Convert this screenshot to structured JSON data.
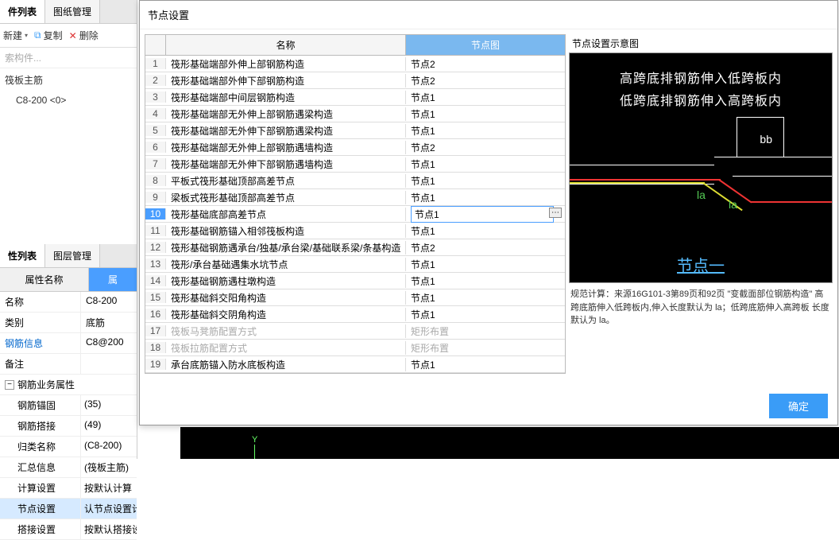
{
  "leftTabs": {
    "t1": "件列表",
    "t2": "图纸管理"
  },
  "toolbar": {
    "new": "新建",
    "copy": "复制",
    "del": "删除"
  },
  "search_placeholder": "索构件...",
  "section": "筏板主筋",
  "treeItem": "C8-200 <0>",
  "lowerTabs": {
    "t1": "性列表",
    "t2": "图层管理"
  },
  "propHeader": {
    "name": "属性名称",
    "value": "属"
  },
  "props": [
    {
      "k": "名称",
      "v": "C8-200",
      "link": false
    },
    {
      "k": "类别",
      "v": "底筋",
      "link": false
    },
    {
      "k": "钢筋信息",
      "v": "C8@200",
      "link": true
    },
    {
      "k": "备注",
      "v": "",
      "link": false
    }
  ],
  "propGroup": "钢筋业务属性",
  "subProps": [
    {
      "k": "钢筋锚固",
      "v": "(35)"
    },
    {
      "k": "钢筋搭接",
      "v": "(49)"
    },
    {
      "k": "归类名称",
      "v": "(C8-200)"
    },
    {
      "k": "汇总信息",
      "v": "(筏板主筋)"
    },
    {
      "k": "计算设置",
      "v": "按默认计算"
    },
    {
      "k": "节点设置",
      "v": "认节点设置计算",
      "sel": true
    },
    {
      "k": "搭接设置",
      "v": "按默认搭接设置..."
    }
  ],
  "dialog": {
    "title": "节点设置",
    "headers": {
      "name": "名称",
      "node": "节点图"
    },
    "rows": [
      {
        "n": 1,
        "name": "筏形基础端部外伸上部钢筋构造",
        "node": "节点2"
      },
      {
        "n": 2,
        "name": "筏形基础端部外伸下部钢筋构造",
        "node": "节点2"
      },
      {
        "n": 3,
        "name": "筏形基础端部中间层钢筋构造",
        "node": "节点1"
      },
      {
        "n": 4,
        "name": "筏形基础端部无外伸上部钢筋遇梁构造",
        "node": "节点1"
      },
      {
        "n": 5,
        "name": "筏形基础端部无外伸下部钢筋遇梁构造",
        "node": "节点1"
      },
      {
        "n": 6,
        "name": "筏形基础端部无外伸上部钢筋遇墙构造",
        "node": "节点2"
      },
      {
        "n": 7,
        "name": "筏形基础端部无外伸下部钢筋遇墙构造",
        "node": "节点1"
      },
      {
        "n": 8,
        "name": "平板式筏形基础顶部高差节点",
        "node": "节点1"
      },
      {
        "n": 9,
        "name": "梁板式筏形基础顶部高差节点",
        "node": "节点1"
      },
      {
        "n": 10,
        "name": "筏形基础底部高差节点",
        "node": "节点1",
        "selected": true
      },
      {
        "n": 11,
        "name": "筏形基础钢筋锚入相邻筏板构造",
        "node": "节点1"
      },
      {
        "n": 12,
        "name": "筏形基础钢筋遇承台/独基/承台梁/基础联系梁/条基构造",
        "node": "节点2"
      },
      {
        "n": 13,
        "name": "筏形/承台基础遇集水坑节点",
        "node": "节点1"
      },
      {
        "n": 14,
        "name": "筏形基础钢筋遇柱墩构造",
        "node": "节点1"
      },
      {
        "n": 15,
        "name": "筏形基础斜交阳角构造",
        "node": "节点1"
      },
      {
        "n": 16,
        "name": "筏形基础斜交阴角构造",
        "node": "节点1"
      },
      {
        "n": 17,
        "name": "筏板马凳筋配置方式",
        "node": "矩形布置",
        "disabled": true
      },
      {
        "n": 18,
        "name": "筏板拉筋配置方式",
        "node": "矩形布置",
        "disabled": true
      },
      {
        "n": 19,
        "name": "承台底筋锚入防水底板构造",
        "node": "节点1"
      }
    ],
    "preview": {
      "title": "节点设置示意图",
      "line1": "高跨底排钢筋伸入低跨板内",
      "line2": "低跨底排钢筋伸入高跨板内",
      "bb": "bb",
      "la": "la",
      "nodeLabel": "节点一",
      "desc": "规范计算：来源16G101-3第89页和92页 \"变截面部位钢筋构造\" 高跨底筋伸入低跨板内,伸入长度默认为 la；低跨底筋伸入高跨板 长度默认为 la。"
    },
    "ok": "确定"
  },
  "axis": "Y"
}
